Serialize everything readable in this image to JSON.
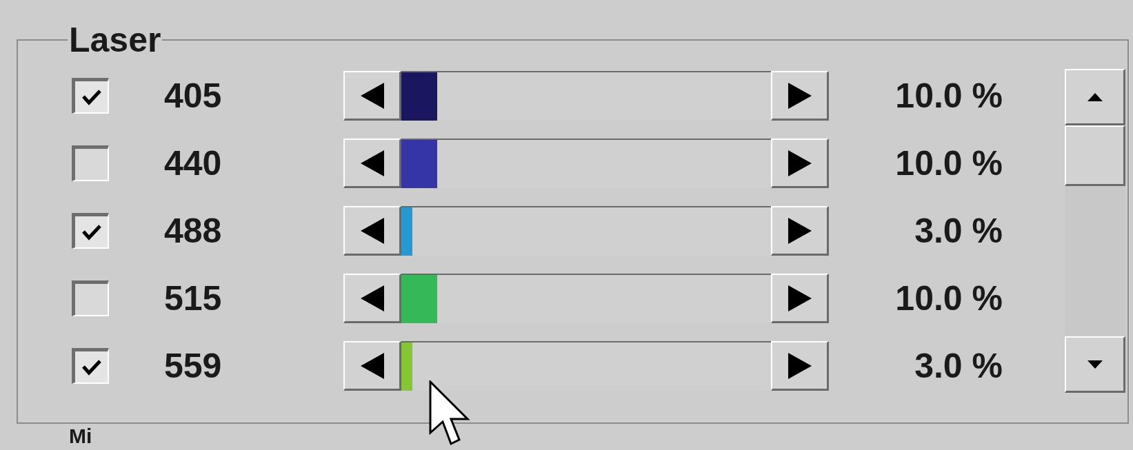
{
  "group": {
    "title": "Laser"
  },
  "lasers": [
    {
      "wavelength": "405",
      "checked": true,
      "level": 0.1,
      "color": "#1b1660",
      "reading": "10.0 %"
    },
    {
      "wavelength": "440",
      "checked": false,
      "level": 0.1,
      "color": "#3535a8",
      "reading": "10.0 %"
    },
    {
      "wavelength": "488",
      "checked": true,
      "level": 0.03,
      "color": "#2a98d0",
      "reading": "3.0 %"
    },
    {
      "wavelength": "515",
      "checked": false,
      "level": 0.1,
      "color": "#34b858",
      "reading": "10.0 %"
    },
    {
      "wavelength": "559",
      "checked": true,
      "level": 0.03,
      "color": "#86c636",
      "reading": "3.0 %"
    }
  ],
  "next_group": {
    "title": "Mi"
  }
}
